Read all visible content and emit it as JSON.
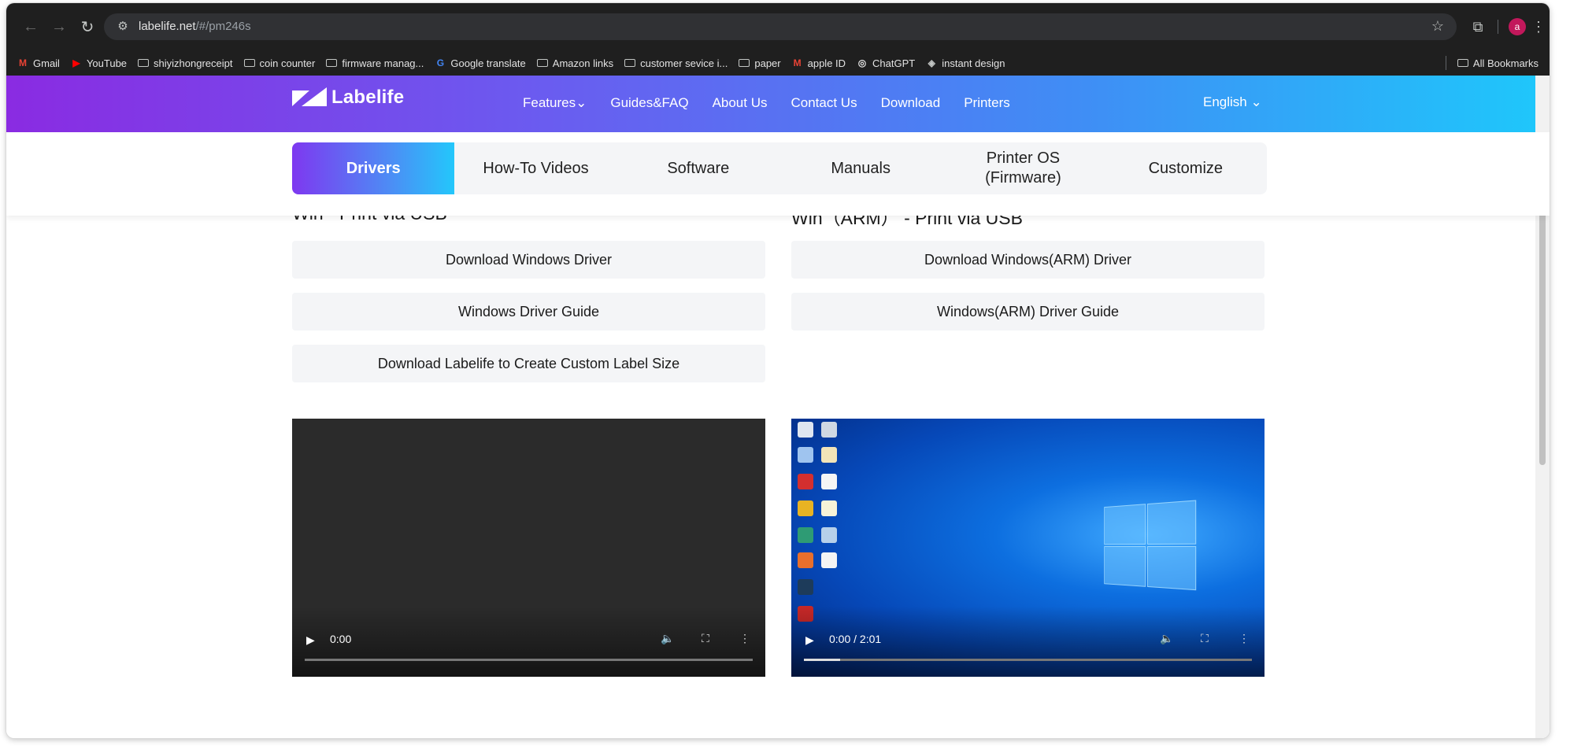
{
  "browser": {
    "url_host": "labelife.net",
    "url_path": "/#/pm246s",
    "profile_initial": "a"
  },
  "bookmarks": [
    {
      "label": "Gmail",
      "icon": "gmail-icon"
    },
    {
      "label": "YouTube",
      "icon": "youtube-icon"
    },
    {
      "label": "shiyizhongreceipt",
      "icon": "folder-icon"
    },
    {
      "label": "coin counter",
      "icon": "folder-icon"
    },
    {
      "label": "firmware manag...",
      "icon": "folder-icon"
    },
    {
      "label": "Google translate",
      "icon": "translate-icon"
    },
    {
      "label": "Amazon links",
      "icon": "folder-icon"
    },
    {
      "label": "customer sevice i...",
      "icon": "folder-icon"
    },
    {
      "label": "paper",
      "icon": "folder-icon"
    },
    {
      "label": "apple ID",
      "icon": "gmail-icon"
    },
    {
      "label": "ChatGPT",
      "icon": "chatgpt-icon"
    },
    {
      "label": "instant design",
      "icon": "design-icon"
    }
  ],
  "all_bookmarks": "All Bookmarks",
  "site": {
    "logo_text": "Labelife",
    "nav": [
      "Features",
      "Guides&FAQ",
      "About Us",
      "Contact Us",
      "Download",
      "Printers"
    ],
    "language": "English"
  },
  "tabs": [
    "Drivers",
    "How-To Videos",
    "Software",
    "Manuals",
    "Printer OS\n(Firmware)",
    "Customize"
  ],
  "left_col": {
    "title": "Win - Print via USB",
    "buttons": [
      "Download Windows Driver",
      "Windows Driver Guide",
      "Download Labelife to Create Custom Label Size"
    ],
    "video_time": "0:00",
    "video_progress": 0
  },
  "right_col": {
    "title": "Win（ARM） - Print via USB",
    "buttons": [
      "Download Windows(ARM) Driver",
      "Windows(ARM) Driver Guide"
    ],
    "video_time": "0:00 / 2:01",
    "video_progress": 0.08
  },
  "colors": {
    "header_gradient_start": "#8a2be2",
    "header_gradient_end": "#1ec8fb",
    "button_bg": "#f4f5f7"
  }
}
